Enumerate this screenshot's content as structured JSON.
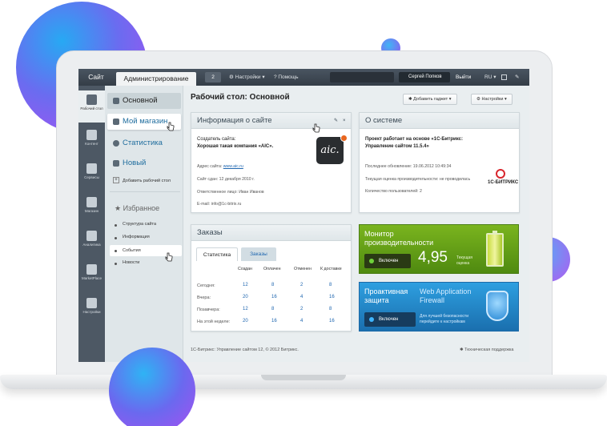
{
  "topbar": {
    "site": "Сайт",
    "admin_tab": "Администрирование",
    "badge": "2",
    "settings": "Настройки",
    "help": "Помощь",
    "user": "Сергей Попков",
    "logout": "Выйти",
    "lang": "RU"
  },
  "rail": {
    "items": [
      "Рабочий стол",
      "Контент",
      "Сервисы",
      "Магазин",
      "Аналитика",
      "MarketPlace",
      "Настройки"
    ]
  },
  "menu": {
    "main": "Основной",
    "shop": "Мой магазин",
    "stats": "Статистика",
    "new": "Новый",
    "add_desktop": "Добавить рабочий стол",
    "favorites": "Избранное",
    "fav_items": [
      "Структура сайта",
      "Информация",
      "События",
      "Новости"
    ]
  },
  "page": {
    "title": "Рабочий стол: Основной",
    "add_gadget": "Добавить гаджет",
    "settings": "Настройки"
  },
  "site_info": {
    "title": "Информация о сайте",
    "creator_label": "Создатель сайта:",
    "creator_value": "Хорошая такая компания «AIC».",
    "addr_label": "Адрес сайта:",
    "addr_link": "www.aic.ru",
    "date": "Сайт сдан: 12 декабря 2010 г.",
    "person": "Ответственное лицо: Иван Иванов",
    "email": "E-mail: info@1c-bitrix.ru",
    "logo": "aic."
  },
  "system": {
    "title": "О системе",
    "project": "Проект работает на основе «1С-Битрикс:",
    "product": "Управление сайтом 11.5.4»",
    "last_update": "Последнее обновление: 19.06.2012 10:49:34",
    "perf": "Текущая оценка производительности: не проводилась",
    "users": "Количество пользователей: 2",
    "brand": "1С-БИТРИКС"
  },
  "orders": {
    "title": "Заказы",
    "tab_stats": "Статистика",
    "tab_orders": "Заказы",
    "columns": [
      "Создан",
      "Оплачен",
      "Отменен",
      "К доставке"
    ],
    "rows": [
      {
        "label": "Сегодня:",
        "values": [
          "12",
          "8",
          "2",
          "8"
        ]
      },
      {
        "label": "Вчера:",
        "values": [
          "20",
          "16",
          "4",
          "16"
        ]
      },
      {
        "label": "Позавчера:",
        "values": [
          "12",
          "8",
          "2",
          "8"
        ]
      },
      {
        "label": "На этой неделе:",
        "values": [
          "20",
          "16",
          "4",
          "16"
        ]
      }
    ]
  },
  "monitor": {
    "title": "Монитор производительности",
    "button": "Включен",
    "score": "4,95",
    "score_label_1": "Текущая",
    "score_label_2": "оценка"
  },
  "firewall": {
    "title": "Проактивная защита",
    "subtitle": "Web Application Firewall",
    "button": "Включен",
    "note_1": "Для лучшей безопасности",
    "note_2": "перейдите к настройкам"
  },
  "footer": {
    "copyright": "1С-Битрикс: Управление сайтом 12, © 2012 Битрикс.",
    "support": "Техническая поддержка"
  }
}
